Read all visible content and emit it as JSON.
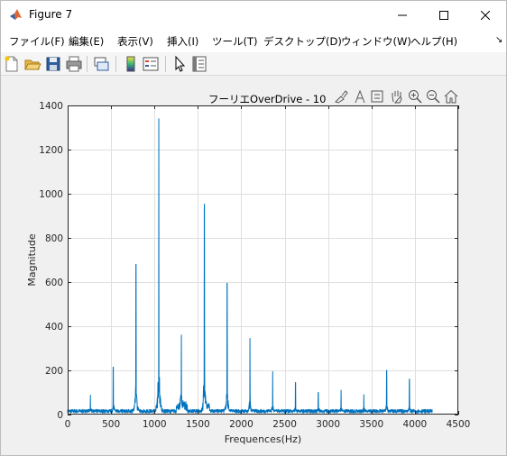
{
  "window": {
    "title": "Figure 7",
    "controls": {
      "minimize": "minimize",
      "maximize": "maximize",
      "close": "close"
    }
  },
  "menu": [
    {
      "label": "ファイル(F)"
    },
    {
      "label": "編集(E)"
    },
    {
      "label": "表示(V)"
    },
    {
      "label": "挿入(I)"
    },
    {
      "label": "ツール(T)"
    },
    {
      "label": "デスクトップ(D)"
    },
    {
      "label": "ウィンドウ(W)"
    },
    {
      "label": "ヘルプ(H)"
    }
  ],
  "menu_overflow_icon": "dock-arrow-icon",
  "toolbar": [
    "new-figure-icon",
    "open-file-icon",
    "save-icon",
    "print-icon",
    "link-plot-icon",
    "insert-colorbar-icon",
    "insert-legend-icon",
    "edit-plot-icon",
    "property-inspector-icon"
  ],
  "axes_toolbar": [
    "brush-icon",
    "data-tips-icon",
    "save-axes-icon",
    "pan-icon",
    "zoom-in-icon",
    "zoom-out-icon",
    "home-icon"
  ],
  "colors": {
    "line": "#0072bd",
    "grid": "#dfdfdf",
    "axes_bg": "#ffffff",
    "figure_bg": "#f0f0f0"
  },
  "chart_data": {
    "type": "line",
    "title": "フーリエOverDrive - 10",
    "xlabel": "Frequences(Hz)",
    "ylabel": "Magnitude",
    "xlim": [
      0,
      4500
    ],
    "ylim": [
      0,
      1400
    ],
    "xticks": [
      0,
      500,
      1000,
      1500,
      2000,
      2500,
      3000,
      3500,
      4000,
      4500
    ],
    "yticks": [
      0,
      200,
      400,
      600,
      800,
      1000,
      1200,
      1400
    ],
    "grid": true,
    "x_range": [
      0,
      4200
    ],
    "baseline": 18,
    "peaks": [
      {
        "x": 262,
        "y": 88
      },
      {
        "x": 525,
        "y": 215
      },
      {
        "x": 787,
        "y": 680
      },
      {
        "x": 1050,
        "y": 1340
      },
      {
        "x": 1310,
        "y": 345
      },
      {
        "x": 1575,
        "y": 925
      },
      {
        "x": 1837,
        "y": 595
      },
      {
        "x": 2100,
        "y": 345
      },
      {
        "x": 2362,
        "y": 195
      },
      {
        "x": 2625,
        "y": 145
      },
      {
        "x": 2887,
        "y": 100
      },
      {
        "x": 3150,
        "y": 110
      },
      {
        "x": 3412,
        "y": 90
      },
      {
        "x": 3675,
        "y": 200
      },
      {
        "x": 3937,
        "y": 160
      }
    ]
  }
}
